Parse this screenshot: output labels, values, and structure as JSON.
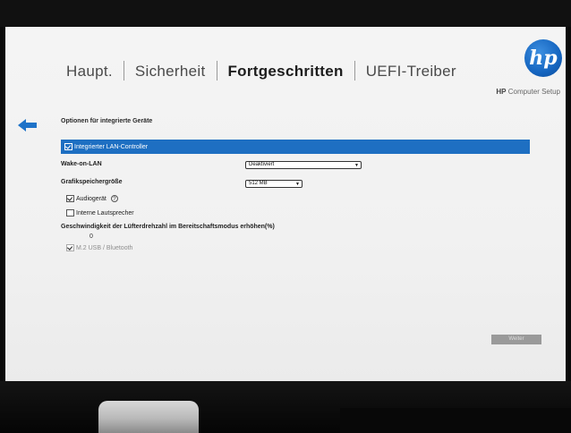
{
  "tabs": [
    {
      "label": "Haupt.",
      "active": false
    },
    {
      "label": "Sicherheit",
      "active": false
    },
    {
      "label": "Fortgeschritten",
      "active": true
    },
    {
      "label": "UEFI-Treiber",
      "active": false
    }
  ],
  "brand": {
    "logo_text": "hp",
    "app_name_bold": "HP",
    "app_name": "Computer Setup"
  },
  "page": {
    "section_title": "Optionen für integrierte Geräte"
  },
  "lan_controller": {
    "label": "Integrierter LAN-Controller",
    "checked": true
  },
  "wake_on_lan": {
    "label": "Wake-on-LAN",
    "value": "Deaktiviert"
  },
  "graphics_memory": {
    "label": "Grafikspeichergröße",
    "value": "512 MB"
  },
  "audio_device": {
    "label": "Audiogerät",
    "checked": true,
    "info": "?"
  },
  "internal_speaker": {
    "label": "Interne Lautsprecher",
    "checked": false
  },
  "fan_speed": {
    "label": "Geschwindigkeit der Lüfterdrehzahl im Bereitschaftsmodus erhöhen(%)",
    "value": "0"
  },
  "m2_usb": {
    "label": "M.2 USB / Bluetooth",
    "checked": true,
    "disabled": true
  },
  "buttons": {
    "next": "Weiter"
  },
  "colors": {
    "accent": "#1e6fc2",
    "hp_blue": "#1565c0"
  }
}
